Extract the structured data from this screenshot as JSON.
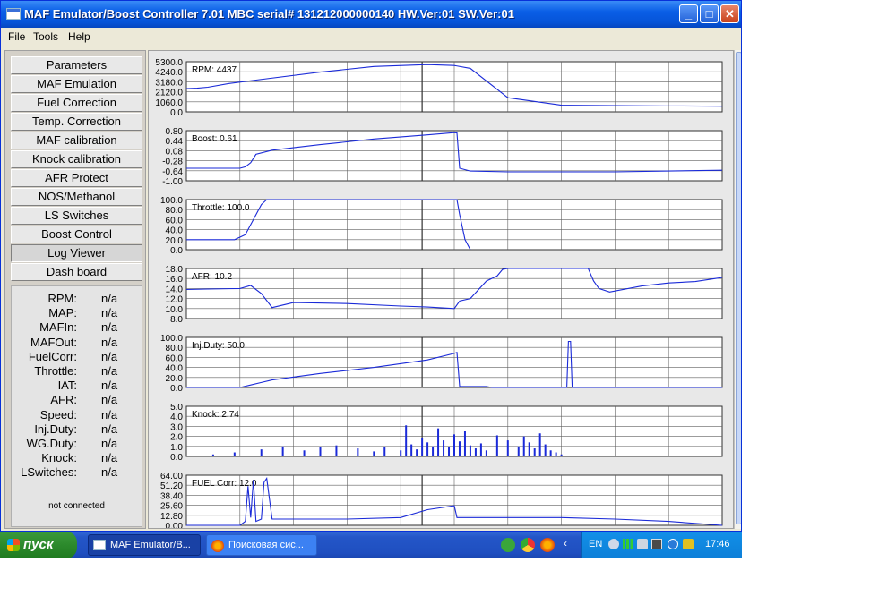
{
  "window": {
    "title": "MAF Emulator/Boost Controller 7.01   MBC serial# 131212000000140 HW.Ver:01 SW.Ver:01",
    "min_glyph": "_",
    "max_glyph": "□",
    "close_glyph": "✕"
  },
  "menu": [
    "File",
    "Tools",
    "Help"
  ],
  "nav": [
    {
      "label": "Parameters",
      "active": false
    },
    {
      "label": "MAF Emulation",
      "active": false
    },
    {
      "label": "Fuel Correction",
      "active": false
    },
    {
      "label": "Temp. Correction",
      "active": false
    },
    {
      "label": "MAF calibration",
      "active": false
    },
    {
      "label": "Knock calibration",
      "active": false
    },
    {
      "label": "AFR Protect",
      "active": false
    },
    {
      "label": "NOS/Methanol",
      "active": false
    },
    {
      "label": "LS Switches",
      "active": false
    },
    {
      "label": "Boost Control",
      "active": false
    },
    {
      "label": "Log Viewer",
      "active": true
    },
    {
      "label": "Dash board",
      "active": false
    }
  ],
  "status": [
    {
      "label": "RPM:",
      "value": "n/a"
    },
    {
      "label": "MAP:",
      "value": "n/a"
    },
    {
      "label": "MAFIn:",
      "value": "n/a"
    },
    {
      "label": "MAFOut:",
      "value": "n/a"
    },
    {
      "label": "FuelCorr:",
      "value": "n/a"
    },
    {
      "label": "Throttle:",
      "value": "n/a"
    },
    {
      "label": "IAT:",
      "value": "n/a"
    },
    {
      "label": "AFR:",
      "value": "n/a"
    },
    {
      "label": "Speed:",
      "value": "n/a"
    },
    {
      "label": "Inj.Duty:",
      "value": "n/a"
    },
    {
      "label": "WG.Duty:",
      "value": "n/a"
    },
    {
      "label": "Knock:",
      "value": "n/a"
    },
    {
      "label": "LSwitches:",
      "value": "n/a"
    }
  ],
  "connection": "not connected",
  "colors": {
    "trace": "#1a2ad8",
    "grid": "#606060",
    "cursor": "#303030"
  },
  "chart_data": [
    {
      "type": "line",
      "label": "RPM: 4437",
      "ticks": [
        "5300.0",
        "4240.0",
        "3180.0",
        "2120.0",
        "1060.0",
        "0.0"
      ],
      "ylim": [
        0,
        5300
      ],
      "x": [
        0,
        2,
        4,
        8,
        15,
        25,
        35,
        45,
        50,
        53,
        60,
        70,
        80,
        90,
        100
      ],
      "y": [
        2450,
        2500,
        2600,
        3000,
        3500,
        4200,
        4800,
        5000,
        4900,
        4600,
        1500,
        700,
        650,
        620,
        600
      ]
    },
    {
      "type": "line",
      "label": "Boost: 0.61",
      "ticks": [
        "0.80",
        "0.44",
        "0.08",
        "-0.28",
        "-0.64",
        "-1.00"
      ],
      "ylim": [
        -1.0,
        0.8
      ],
      "x": [
        0,
        10,
        11,
        12,
        13,
        16,
        25,
        35,
        45,
        50,
        50.5,
        51,
        53,
        60,
        65,
        72,
        80,
        90,
        100
      ],
      "y": [
        -0.55,
        -0.55,
        -0.5,
        -0.35,
        -0.05,
        0.1,
        0.3,
        0.5,
        0.65,
        0.73,
        0.72,
        -0.55,
        -0.65,
        -0.68,
        -0.68,
        -0.68,
        -0.68,
        -0.65,
        -0.62
      ]
    },
    {
      "type": "line",
      "label": "Throttle: 100.0",
      "ticks": [
        "100.0",
        "80.0",
        "60.0",
        "40.0",
        "20.0",
        "0.0"
      ],
      "ylim": [
        0,
        100
      ],
      "x": [
        0,
        9,
        11,
        12.5,
        14,
        15,
        50,
        50.5,
        51,
        52,
        53
      ],
      "y": [
        20,
        20,
        30,
        60,
        90,
        100,
        100,
        100,
        70,
        20,
        0
      ]
    },
    {
      "type": "line",
      "label": "AFR: 10.2",
      "ticks": [
        "18.0",
        "16.0",
        "14.0",
        "12.0",
        "10.0",
        "8.0"
      ],
      "ylim": [
        8,
        18
      ],
      "x": [
        0,
        4,
        10,
        12,
        14,
        16,
        20,
        30,
        40,
        45,
        50,
        51,
        53,
        56,
        58,
        59,
        60,
        75,
        76,
        77,
        79,
        85,
        90,
        95,
        100
      ],
      "y": [
        13.8,
        13.9,
        14.0,
        14.6,
        13.0,
        10.2,
        11.2,
        11.0,
        10.5,
        10.3,
        10.0,
        11.5,
        12.0,
        15.5,
        16.5,
        17.8,
        18.0,
        18.0,
        15.5,
        14.0,
        13.3,
        14.5,
        15.1,
        15.4,
        16.2
      ]
    },
    {
      "type": "line",
      "label": "Inj.Duty: 50.0",
      "ticks": [
        "100.0",
        "80.0",
        "60.0",
        "40.0",
        "20.0",
        "0.0"
      ],
      "ylim": [
        0,
        100
      ],
      "x": [
        0,
        10,
        12,
        14,
        16,
        25,
        35,
        45,
        50,
        50.5,
        51,
        56,
        57,
        71,
        71.3,
        71.7,
        72,
        100
      ],
      "y": [
        0,
        0,
        5,
        10,
        15,
        28,
        40,
        55,
        68,
        70,
        2,
        2,
        0,
        0,
        92,
        92,
        0,
        0
      ]
    },
    {
      "type": "bar",
      "label": "Knock: 2.74",
      "ticks": [
        "5.0",
        "4.0",
        "3.0",
        "2.0",
        "1.0",
        "0.0"
      ],
      "ylim": [
        0,
        5
      ],
      "x": [
        5,
        9,
        14,
        18,
        22,
        25,
        28,
        32,
        35,
        37,
        40,
        41,
        42,
        43,
        44,
        45,
        46,
        47,
        48,
        49,
        50,
        51,
        52,
        53,
        54,
        55,
        56,
        58,
        60,
        62,
        63,
        64,
        65,
        66,
        67,
        68,
        69,
        70
      ],
      "y": [
        0.2,
        0.4,
        0.7,
        1.0,
        0.6,
        0.9,
        1.1,
        0.8,
        0.5,
        0.9,
        0.6,
        3.1,
        1.2,
        0.7,
        1.8,
        1.4,
        1.0,
        2.8,
        1.6,
        0.9,
        2.2,
        1.5,
        2.5,
        1.1,
        0.8,
        1.3,
        0.6,
        2.1,
        1.6,
        1.0,
        2.0,
        1.4,
        0.8,
        2.3,
        1.2,
        0.6,
        0.4,
        0.2
      ]
    },
    {
      "type": "line",
      "label": "FUEL Corr: 12.0",
      "ticks": [
        "64.00",
        "51.20",
        "38.40",
        "25.60",
        "12.80",
        "0.00"
      ],
      "ylim": [
        0,
        64
      ],
      "x": [
        0,
        10,
        11,
        11.5,
        12,
        12.5,
        13,
        14,
        14.5,
        15,
        16,
        30,
        40,
        45,
        50,
        50.5,
        60,
        70,
        80,
        90,
        100
      ],
      "y": [
        0,
        0,
        5,
        50,
        10,
        58,
        5,
        8,
        55,
        60,
        8,
        8,
        10,
        20,
        25,
        10,
        10,
        10,
        8,
        5,
        0
      ]
    }
  ],
  "taskbar": {
    "start": "пуск",
    "tasks": [
      "MAF Emulator/B...",
      "Поисковая сис..."
    ],
    "lang": "EN",
    "clock": "17:46"
  }
}
